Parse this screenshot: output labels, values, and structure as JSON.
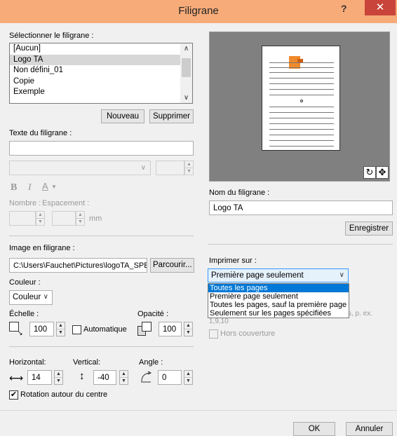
{
  "window": {
    "title": "Filigrane",
    "help": "?",
    "close": "✕"
  },
  "select_section": {
    "label": "Sélectionner le filigrane :",
    "items": [
      "[Aucun]",
      "Logo TA",
      "Non défini_01",
      "Copie",
      "Exemple"
    ],
    "selected_index": 1,
    "new_button": "Nouveau",
    "delete_button": "Supprimer"
  },
  "text_section": {
    "label": "Texte du filigrane :",
    "text_value": "",
    "number_label": "Nombre :",
    "spacing_label": "Espacement :",
    "unit": "mm"
  },
  "image_section": {
    "label": "Image en filigrane :",
    "path": "C:\\Users\\Fauchet\\Pictures\\logoTA_SPE",
    "browse_button": "Parcourir...",
    "color_label": "Couleur :",
    "color_value": "Couleur",
    "scale_label": "Échelle :",
    "scale_value": "100",
    "auto_label": "Automatique",
    "opacity_label": "Opacité :",
    "opacity_value": "100"
  },
  "position_section": {
    "horizontal_label": "Horizontal:",
    "horizontal_value": "14",
    "vertical_label": "Vertical:",
    "vertical_value": "-40",
    "angle_label": "Angle :",
    "angle_value": "0",
    "rotation_label": "Rotation autour du centre",
    "rotation_checked": true
  },
  "name_section": {
    "label": "Nom du filigrane :",
    "value": "Logo TA",
    "save_button": "Enregistrer"
  },
  "print_section": {
    "label": "Imprimer sur :",
    "selected": "Première page seulement",
    "options": [
      "Toutes les pages",
      "Première page seulement",
      "Toutes les pages, sauf la première page",
      "Seulement sur les pages spécifiées"
    ],
    "highlighted_index": 0,
    "hidden_hint_fragment": "s, p. ex.",
    "hidden_hint_fragment2": "1,9,10",
    "out_of_cover_label": "Hors couverture"
  },
  "footer": {
    "ok_button": "OK",
    "cancel_button": "Annuler"
  },
  "colors": {
    "titlebar": "#f6ab79",
    "close": "#c9443a",
    "highlight": "#0078d7",
    "logo_orange": "#f08a2c"
  }
}
